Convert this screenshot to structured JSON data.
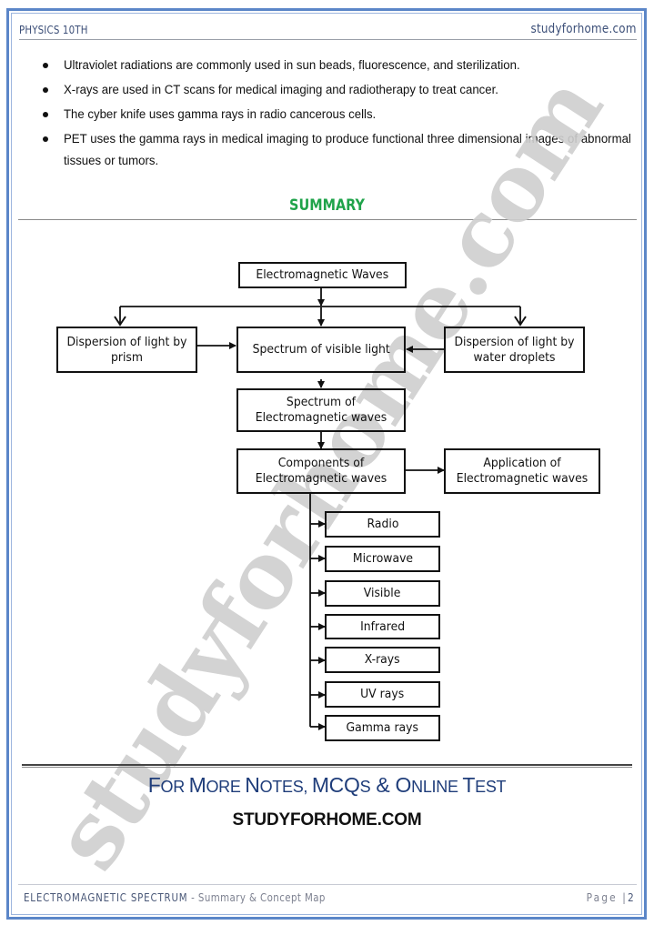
{
  "header": {
    "subject": "PHYSICS 10TH",
    "site": "studyforhome.com"
  },
  "bullets": [
    "Ultraviolet radiations are commonly used in sun beads, fluorescence, and sterilization.",
    "X-rays are used in CT scans for medical imaging and radiotherapy to treat cancer.",
    "The cyber knife uses gamma rays in radio cancerous cells.",
    "PET uses the gamma rays in medical imaging to produce functional three dimensional images of abnormal tissues or tumors."
  ],
  "summary": {
    "title": "SUMMARY",
    "watermark": "studyforhome.com",
    "concept_map": {
      "root": "Electromagnetic Waves",
      "prism": "Dispersion of light by prism",
      "visible_spectrum": "Spectrum of visible light",
      "water": "Dispersion of light by water droplets",
      "em_spectrum": "Spectrum of Electromagnetic waves",
      "components": "Components of Electromagnetic waves",
      "application": "Application of Electromagnetic waves",
      "component_list": [
        "Radio",
        "Microwave",
        "Visible",
        "Infrared",
        "X-rays",
        "UV rays",
        "Gamma rays"
      ]
    }
  },
  "promo": {
    "f1": "F",
    "r1": "OR ",
    "f2": "M",
    "r2": "ORE ",
    "f3": "N",
    "r3": "OTES, ",
    "f4": "MCQ",
    "r4": "S",
    "f5": " & ",
    "f6": "O",
    "r6": "NLINE ",
    "f7": "T",
    "r7": "EST",
    "site": "STUDYFORHOME.COM"
  },
  "footer": {
    "chapter": "ELECTROMAGNETIC SPECTRUM",
    "subtitle": " - Summary & Concept Map",
    "page_label": "Page |",
    "page_number": "2"
  }
}
